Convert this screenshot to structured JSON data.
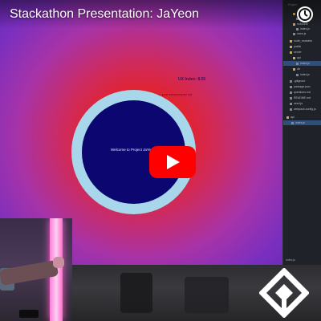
{
  "video": {
    "title": "Stackathon Presentation: JaYeon"
  },
  "slide": {
    "ux_index": "UX Index: 8.55",
    "gone_text": "Gone: 1?? ????????? ??",
    "welcome": "Welcome to Project JaYe"
  },
  "editor": {
    "header": "Project",
    "items": [
      {
        "label": "containers"
      },
      {
        "label": "Main.js"
      },
      {
        "label": "reducers"
      },
      {
        "label": "index.js"
      },
      {
        "label": "store.js"
      },
      {
        "label": "node_modules"
      },
      {
        "label": "public"
      },
      {
        "label": "server"
      },
      {
        "label": "api"
      },
      {
        "label": "index.js"
      },
      {
        "label": "db"
      },
      {
        "label": "index.js"
      },
      {
        "label": ".gitignore"
      },
      {
        "label": "package.json"
      },
      {
        "label": "questions.md"
      },
      {
        "label": "README.md"
      },
      {
        "label": "seed.js"
      },
      {
        "label": "webpack.config.js"
      },
      {
        "label": "api"
      },
      {
        "label": "index.js"
      }
    ],
    "tab": "index.js"
  },
  "colors": {
    "youtube_red": "#ff0000",
    "disc": "#0b0670",
    "ring": "#a8d6ea"
  }
}
